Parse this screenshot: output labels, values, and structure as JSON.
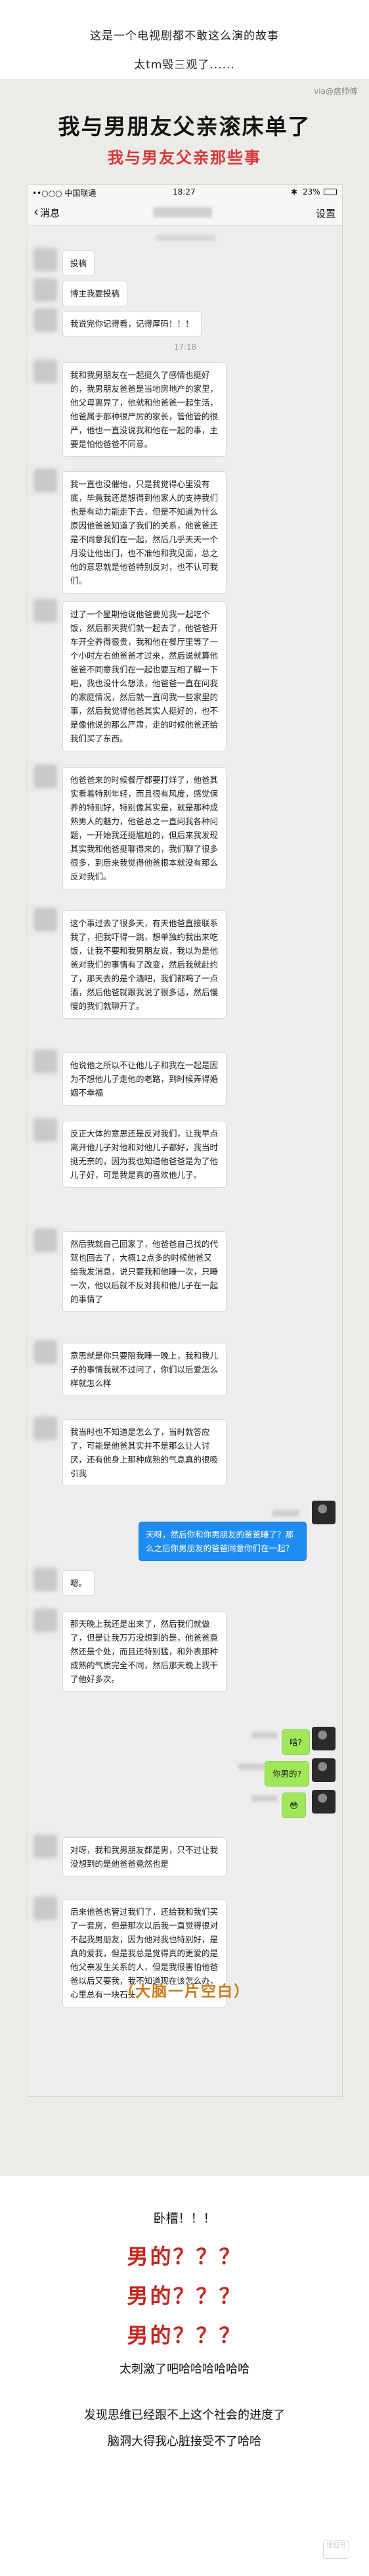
{
  "intro": {
    "line1": "这是一个电视剧都不敢这么演的故事",
    "line2": "太tm毁三观了......"
  },
  "poster": {
    "watermark": "via@痞师傅",
    "headline": "我与男朋友父亲滚床单了",
    "subheadline": "我与男友父亲那些事"
  },
  "statusbar": {
    "carrier": "••○○○ 中国联通",
    "time": "18:27",
    "battery": "23%"
  },
  "navbar": {
    "back_label": "消息",
    "settings_label": "设置"
  },
  "chat": {
    "time_1": "17:18",
    "messages": [
      {
        "side": "left",
        "text": "投稿"
      },
      {
        "side": "left",
        "text": "博主我要投稿"
      },
      {
        "side": "left",
        "text": "我说完你记得看，记得厚码！！！"
      },
      {
        "side": "left",
        "text": "我和我男朋友在一起挺久了感情也挺好的，我男朋友爸爸是当地房地产的家里，他父母离异了，他就和他爸爸一起生活，他爸属于那种很严厉的家长，管他管的很严，他也一直没说我和他在一起的事，主要是怕他爸爸不同意。"
      },
      {
        "side": "left",
        "text": "我一直也没催他，只是我觉得心里没有底，毕竟我还是想得到他家人的支持我们也是有动力能走下去，但是不知道为什么原因他爸爸知道了我们的关系，他爸爸还是不同意我们在一起，然后几乎天天一个月没让他出门，也不准他和我见面，总之他的意思就是他爸特别反对，也不认可我们。"
      },
      {
        "side": "left",
        "text": "过了一个星期他说他爸要见我一起吃个饭，然后那天我们就一起去了，他爸爸开车开全养得很贵，我和他在餐厅里等了一个小时左右他爸爸才过来，然后说就算他爸爸不同意我们在一起也要互相了解一下吧，我也没什么想法，他爸爸一直在问我的家庭情况，然后就一直问我一些家里的事，然后我觉得他爸其实人挺好的，也不是像他说的那么严肃，走的时候他爸还给我们买了东西。"
      },
      {
        "side": "left",
        "text": "他爸爸来的时候餐厅都要打烊了，他爸其实看着特别年轻，而且很有风度，感觉保养的特别好，特别像其实是，就是那种成熟男人的魅力，他爸总之一直问我各种问题，一开始我还挺尴尬的，但后来我发现其实我和他爸挺聊得来的，我们聊了很多很多，到后来我觉得他爸根本就没有那么反对我们。"
      },
      {
        "side": "left",
        "text": "这个事过去了很多天，有天他爸直接联系我了，把我吓得一跳，想单独约我出来吃饭，让我不要和我男朋友说，我以为是他爸对我们的事情有了改变，然后我就赴约了，那天去的是个酒吧，我们都喝了一点酒，然后他爸就跟我说了很多话，然后慢慢的我们就聊开了。"
      },
      {
        "side": "left",
        "text": "他说他之所以不让他儿子和我在一起是因为不想他儿子走他的老路，到时候弄得婚姻不幸福"
      },
      {
        "side": "left",
        "text": "反正大体的意思还是反对我们，让我早点离开他儿子对他和对他儿子都好，我当时挺无奈的，因为我也知道他爸爸是为了他儿子好，可是我是真的喜欢他儿子。"
      },
      {
        "side": "left",
        "text": "然后我就自己回家了，他爸爸自己找的代驾也回去了，大概12点多的时候他爸又给我发消息，说只要我和他睡一次，只睡一次，他以后就不反对我和他儿子在一起的事情了"
      },
      {
        "side": "left",
        "text": "意思就是你只要陪我睡一晚上，我和我儿子的事情我就不过问了，你们以后爱怎么样就怎么样"
      },
      {
        "side": "left",
        "text": "我当时也不知道是怎么了，当时就答应了，可能是他爸其实并不是那么让人讨厌，还有他身上那种成熟的气息真的很吸引我"
      },
      {
        "side": "right",
        "style": "blue",
        "text": "天呀，然后你和你男朋友的爸爸睡了？那么之后你男朋友的爸爸同意你们在一起？"
      },
      {
        "side": "left",
        "text": "嗯。"
      },
      {
        "side": "left",
        "text": "那天晚上我还是出来了，然后我们就做了，但是让我万万没想到的是，他爸爸竟然还是个处，而且还特别猛，和外表那种成熟的气质完全不同，然后那天晚上我干了他好多次。"
      },
      {
        "side": "right",
        "text": "啥?"
      },
      {
        "side": "right",
        "text": "你男的?"
      },
      {
        "side": "right",
        "text": "😳"
      },
      {
        "side": "left",
        "text": "对呀，我和我男朋友都是男，只不过让我没想到的是他爸爸竟然也是"
      },
      {
        "side": "left",
        "text": "后来他爸也管过我们了，还给我和我们买了一套房，但是那次以后我一直觉得很对不起我男朋友，因为他对我也特别好，是真的爱我，但是我总是觉得真的更爱的是他父亲发生关系的人，但是我很害怕他爸爸以后又要我，我不知道现在该怎么办，心里总有一块石头。"
      }
    ]
  },
  "caption_blank": "（大脑一片空白）",
  "reactions": {
    "wotao": "卧槽！！！",
    "nande_1": "男的？？？",
    "nande_2": "男的？？？",
    "nande_3": "男的？？？",
    "laugh": "太刺激了吧哈哈哈哈哈哈",
    "closing_1": "发现思维已经跟不上这个社会的进度了",
    "closing_2": "脑洞大得我心脏接受不了哈哈"
  },
  "corner_logo": "搜狐号",
  "icons": [
    "back-chevron-icon",
    "signal-icon",
    "battery-icon",
    "bluetooth-icon"
  ],
  "colors": {
    "headline_red": "#d53838",
    "bubble_green": "#a0e75a",
    "bubble_blue": "#1e8cf0",
    "caption_orange": "#c97a18",
    "reaction_red": "#c3261f"
  }
}
